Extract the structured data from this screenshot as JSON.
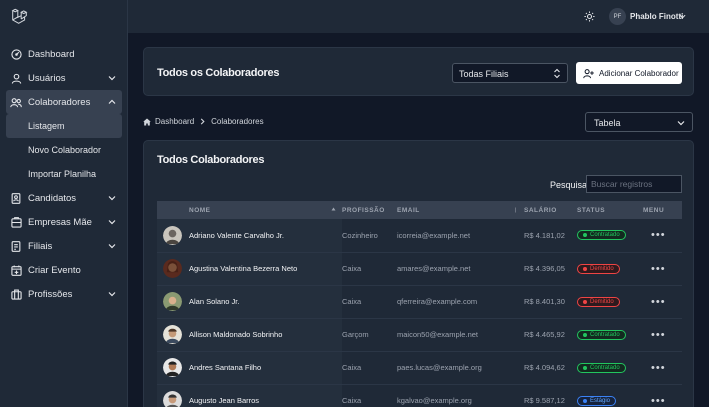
{
  "topbar": {
    "user_initials": "PF",
    "user_name": "Phablo Finotti"
  },
  "sidebar": {
    "items": [
      {
        "label": "Dashboard",
        "icon": "dashboard-icon"
      },
      {
        "label": "Usuários",
        "icon": "user-icon"
      },
      {
        "label": "Colaboradores",
        "icon": "users-icon"
      },
      {
        "label": "Candidatos",
        "icon": "id-card-icon"
      },
      {
        "label": "Empresas Mãe",
        "icon": "building-icon"
      },
      {
        "label": "Filiais",
        "icon": "branch-icon"
      },
      {
        "label": "Criar Evento",
        "icon": "calendar-plus-icon"
      },
      {
        "label": "Profissões",
        "icon": "briefcase-icon"
      }
    ],
    "submenu": [
      "Listagem",
      "Novo Colaborador",
      "Importar Planilha"
    ]
  },
  "header_card": {
    "title": "Todos os Colaboradores",
    "filter_value": "Todas Filiais",
    "add_button": "Adicionar Colaborador"
  },
  "breadcrumb": [
    "Dashboard",
    "Colaboradores"
  ],
  "view_select": "Tabela",
  "table_card": {
    "title": "Todos Colaboradores",
    "search_label": "Pesquisar",
    "search_placeholder": "Buscar registros",
    "columns": [
      "NOME",
      "PROFISSÃO",
      "EMAIL",
      "SALÁRIO",
      "STATUS",
      "MENU"
    ],
    "rows": [
      {
        "name": "Adriano Valente Carvalho Jr.",
        "profession": "Cozinheiro",
        "email": "icorreia@example.net",
        "salary": "R$ 4.181,02",
        "status": "Contratado"
      },
      {
        "name": "Agustina Valentina Bezerra Neto",
        "profession": "Caixa",
        "email": "amares@example.net",
        "salary": "R$ 4.396,05",
        "status": "Demitido"
      },
      {
        "name": "Alan Solano Jr.",
        "profession": "Caixa",
        "email": "qferreira@example.com",
        "salary": "R$ 8.401,30",
        "status": "Demitido"
      },
      {
        "name": "Allison Maldonado Sobrinho",
        "profession": "Garçom",
        "email": "maicon50@example.net",
        "salary": "R$ 4.465,92",
        "status": "Contratado"
      },
      {
        "name": "Andres Santana Filho",
        "profession": "Caixa",
        "email": "paes.lucas@example.org",
        "salary": "R$ 4.094,62",
        "status": "Contratado"
      },
      {
        "name": "Augusto Jean Barros",
        "profession": "Caixa",
        "email": "kgalvao@example.org",
        "salary": "R$ 9.587,12",
        "status": "Estágio"
      }
    ],
    "menu_glyph": "•••"
  },
  "colors": {
    "background": "#111827",
    "panel": "#1f2937",
    "contratado": "#22c55e",
    "demitido": "#ef4444",
    "estagio": "#3b82f6"
  }
}
